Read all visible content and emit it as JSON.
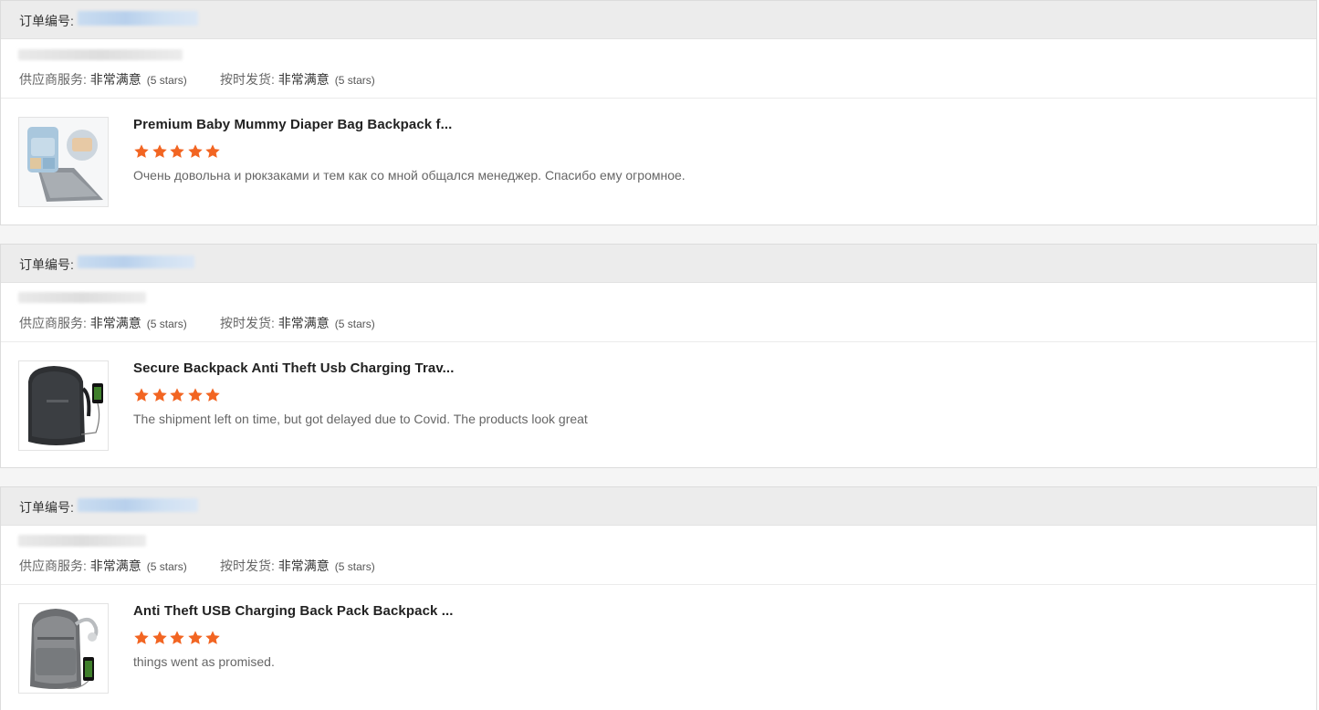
{
  "orders": [
    {
      "order_label": "订单编号:",
      "supplier_label": "供应商服务:",
      "supplier_value": "非常满意",
      "supplier_stars": "(5 stars)",
      "shipping_label": "按时发货:",
      "shipping_value": "非常满意",
      "shipping_stars": "(5 stars)",
      "product_title": "Premium Baby Mummy Diaper Bag Backpack f...",
      "rating": 5,
      "comment": "Очень довольна и рюкзаками и тем как со мной общался менеджер. Спасибо ему огромное."
    },
    {
      "order_label": "订单编号:",
      "supplier_label": "供应商服务:",
      "supplier_value": "非常满意",
      "supplier_stars": "(5 stars)",
      "shipping_label": "按时发货:",
      "shipping_value": "非常满意",
      "shipping_stars": "(5 stars)",
      "product_title": "Secure Backpack Anti Theft Usb Charging Trav...",
      "rating": 5,
      "comment": "The shipment left on time, but got delayed due to Covid. The products look great"
    },
    {
      "order_label": "订单编号:",
      "supplier_label": "供应商服务:",
      "supplier_value": "非常满意",
      "supplier_stars": "(5 stars)",
      "shipping_label": "按时发货:",
      "shipping_value": "非常满意",
      "shipping_stars": "(5 stars)",
      "product_title": "Anti Theft USB Charging Back Pack Backpack ...",
      "rating": 5,
      "comment": "things went as promised."
    }
  ],
  "colors": {
    "star": "#f26522",
    "header_bg": "#ececec"
  }
}
